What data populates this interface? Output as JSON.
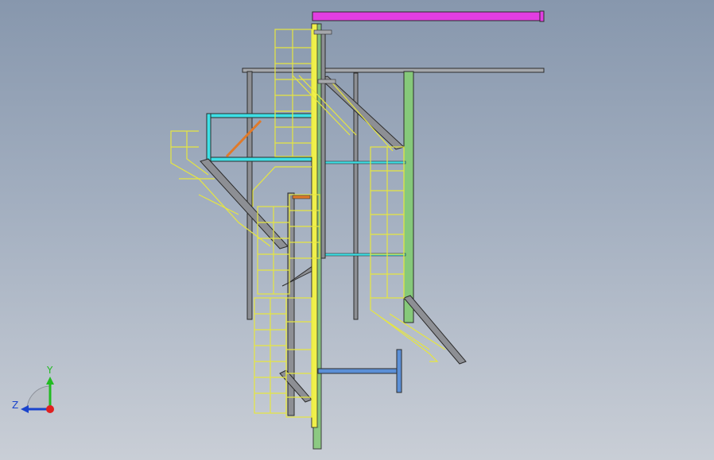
{
  "viewport": {
    "background_top": "#8797ad",
    "background_bottom": "#c9ced6"
  },
  "triad": {
    "y_label": "Y",
    "z_label": "Z",
    "y_color": "#22bb22",
    "z_color": "#1a44cc",
    "x_color": "#e02020"
  },
  "colors": {
    "magenta_beam": "#e23ee2",
    "gray_steel": "#8d8f94",
    "green_column": "#86c97a",
    "yellow_post": "#f0f04a",
    "cyan_frame": "#3ee0e6",
    "blue_beam": "#5b8fd6",
    "orange_brace": "#e07a2a",
    "railing": "#e6e640",
    "edge_dark": "#2c2c2c"
  }
}
